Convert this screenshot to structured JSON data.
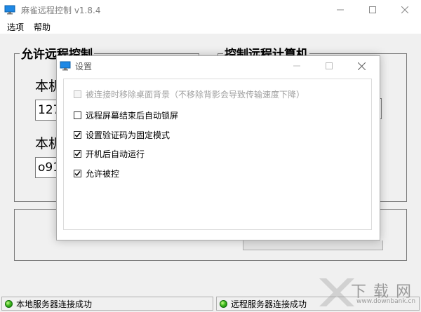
{
  "window": {
    "title": "麻雀远程控制 v1.8.4"
  },
  "menu": [
    "选项",
    "帮助"
  ],
  "left_group": {
    "title": "允许远程控制",
    "label1": "本机",
    "value1": "127",
    "label2": "本机",
    "value2": "o91"
  },
  "right_group": {
    "title": "控制远程计算机"
  },
  "status": {
    "local": "本地服务器连接成功",
    "remote": "远程服务器连接成功"
  },
  "dialog": {
    "title": "设置",
    "options": [
      {
        "label": "被连接时移除桌面背景（不移除背影会导致传输速度下降）",
        "checked": false,
        "enabled": false
      },
      {
        "label": "远程屏幕结束后自动锁屏",
        "checked": false,
        "enabled": true
      },
      {
        "label": "设置验证码为固定模式",
        "checked": true,
        "enabled": true
      },
      {
        "label": "开机后自动运行",
        "checked": true,
        "enabled": true
      },
      {
        "label": "允许被控",
        "checked": true,
        "enabled": true
      }
    ]
  },
  "watermark": {
    "text": "下载网",
    "url": "www.downbank.cn"
  },
  "colors": {
    "status_green": "#3fb920",
    "monitor_blue": "#1e88e5"
  }
}
